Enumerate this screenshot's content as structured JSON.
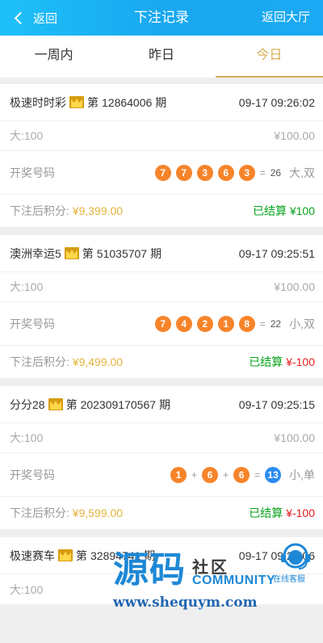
{
  "header": {
    "back_label": "返回",
    "title": "下注记录",
    "lobby_label": "返回大厅"
  },
  "tabs": [
    {
      "label": "一周内",
      "active": false
    },
    {
      "label": "昨日",
      "active": false
    },
    {
      "label": "今日",
      "active": true
    }
  ],
  "records": [
    {
      "game": "极速时时彩",
      "issue_prefix": "第",
      "issue": "12864006",
      "issue_suffix": "期",
      "time": "09-17 09:26:02",
      "bet": "大:100",
      "bet_amount": "¥100.00",
      "draw_label": "开奖号码",
      "balls": [
        "7",
        "7",
        "3",
        "6",
        "3"
      ],
      "sum": "26",
      "result": "大,双",
      "score_label": "下注后积分:",
      "score": "¥9,399.00",
      "settle_label": "已结算",
      "settle_amount": "¥100"
    },
    {
      "game": "澳洲幸运5",
      "issue_prefix": "第",
      "issue": "51035707",
      "issue_suffix": "期",
      "time": "09-17 09:25:51",
      "bet": "大:100",
      "bet_amount": "¥100.00",
      "draw_label": "开奖号码",
      "balls": [
        "7",
        "4",
        "2",
        "1",
        "8"
      ],
      "sum": "22",
      "result": "小,双",
      "score_label": "下注后积分:",
      "score": "¥9,499.00",
      "settle_label": "已结算",
      "settle_amount": "¥-100"
    },
    {
      "game": "分分28",
      "issue_prefix": "第",
      "issue": "202309170567",
      "issue_suffix": "期",
      "time": "09-17 09:25:15",
      "bet": "大:100",
      "bet_amount": "¥100.00",
      "draw_label": "开奖号码",
      "balls": [
        "1",
        "6",
        "6"
      ],
      "sum": "13",
      "result": "小,单",
      "score_label": "下注后积分:",
      "score": "¥9,599.00",
      "settle_label": "已结算",
      "settle_amount": "¥-100"
    },
    {
      "game": "极速赛车",
      "issue_prefix": "第",
      "issue": "32894741",
      "issue_suffix": "期",
      "time": "09-17 09:25:06",
      "bet": "大:100"
    }
  ],
  "watermark": {
    "big": "源码",
    "she_qu": "社区",
    "community": "COMMUNITY",
    "url": "www.shequym.com",
    "service": "在线客服"
  },
  "colors": {
    "header_from": "#1ec0f8",
    "header_to": "#1aa9f2",
    "accent": "#d9ae54",
    "ball": "#f7842a",
    "ball_sum": "#2b8cf2",
    "settled": "#07a31c",
    "negative": "#e41e1e",
    "score": "#e2b33b"
  },
  "icons": {
    "back": "chevron-left-icon",
    "crown": "crown-icon",
    "service": "customer-service-icon"
  }
}
